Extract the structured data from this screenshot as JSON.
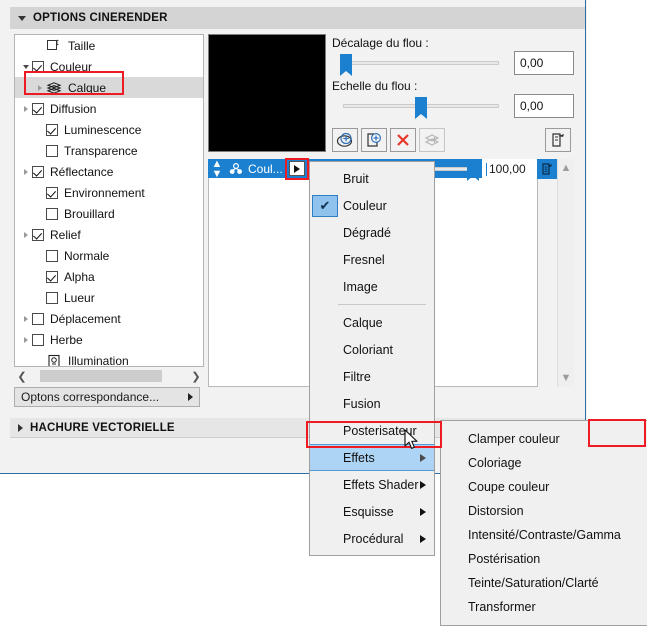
{
  "sections": {
    "cinerender": {
      "title": "OPTIONS CINERENDER",
      "expanded": true
    },
    "hachure": {
      "title": "HACHURE VECTORIELLE",
      "expanded": false
    }
  },
  "tree": {
    "items": [
      {
        "label": "Taille",
        "icon": "size-icon",
        "checkbox": "none",
        "arrow": "none",
        "depth": 1,
        "selected": false
      },
      {
        "label": "Couleur",
        "icon": "none",
        "checkbox": "checked",
        "arrow": "open",
        "depth": 0,
        "selected": false
      },
      {
        "label": "Calque",
        "icon": "layers-icon",
        "checkbox": "none",
        "arrow": "closed",
        "depth": 1,
        "selected": true
      },
      {
        "label": "Diffusion",
        "icon": "none",
        "checkbox": "checked",
        "arrow": "closed",
        "depth": 0,
        "selected": false
      },
      {
        "label": "Luminescence",
        "icon": "none",
        "checkbox": "checked",
        "arrow": "none",
        "depth": 1,
        "selected": false
      },
      {
        "label": "Transparence",
        "icon": "none",
        "checkbox": "unchecked",
        "arrow": "none",
        "depth": 1,
        "selected": false
      },
      {
        "label": "Réflectance",
        "icon": "none",
        "checkbox": "checked",
        "arrow": "closed",
        "depth": 0,
        "selected": false
      },
      {
        "label": "Environnement",
        "icon": "none",
        "checkbox": "checked",
        "arrow": "none",
        "depth": 1,
        "selected": false
      },
      {
        "label": "Brouillard",
        "icon": "none",
        "checkbox": "unchecked",
        "arrow": "none",
        "depth": 1,
        "selected": false
      },
      {
        "label": "Relief",
        "icon": "none",
        "checkbox": "checked",
        "arrow": "closed",
        "depth": 0,
        "selected": false
      },
      {
        "label": "Normale",
        "icon": "none",
        "checkbox": "unchecked",
        "arrow": "none",
        "depth": 1,
        "selected": false
      },
      {
        "label": "Alpha",
        "icon": "none",
        "checkbox": "checked",
        "arrow": "none",
        "depth": 1,
        "selected": false
      },
      {
        "label": "Lueur",
        "icon": "none",
        "checkbox": "unchecked",
        "arrow": "none",
        "depth": 1,
        "selected": false
      },
      {
        "label": "Déplacement",
        "icon": "none",
        "checkbox": "unchecked",
        "arrow": "closed",
        "depth": 0,
        "selected": false
      },
      {
        "label": "Herbe",
        "icon": "none",
        "checkbox": "unchecked",
        "arrow": "closed",
        "depth": 0,
        "selected": false
      },
      {
        "label": "Illumination",
        "icon": "illumination-icon",
        "checkbox": "none",
        "arrow": "none",
        "depth": 1,
        "selected": false
      }
    ]
  },
  "tree_footer": {
    "options_button": "Optons correspondance..."
  },
  "properties": {
    "blur_offset_label": "Décalage du flou :",
    "blur_offset_value": "0,00",
    "blur_scale_label": "Echelle du flou :",
    "blur_scale_value": "0,00"
  },
  "toolbar": {
    "buttons": [
      {
        "name": "add-shader-button",
        "icon": "sphere-plus-icon",
        "enabled": true
      },
      {
        "name": "add-image-button",
        "icon": "page-plus-icon",
        "enabled": true
      },
      {
        "name": "delete-button",
        "icon": "red-x-icon",
        "enabled": true
      },
      {
        "name": "duplicate-layer-button",
        "icon": "layers-arrow-icon",
        "enabled": false
      }
    ],
    "export_button": {
      "name": "export-icon",
      "icon": "page-arrow-icon"
    }
  },
  "layer_row": {
    "name": "Coul...",
    "icon": "shader-dots-icon",
    "popup_arrow": "play-arrow-icon",
    "opacity_value": "100,00",
    "opacity_slider_percent": 100
  },
  "menu": {
    "items": [
      {
        "label": "Bruit",
        "checked": false,
        "submenu": false,
        "highlight": false
      },
      {
        "label": "Couleur",
        "checked": true,
        "submenu": false,
        "highlight": false
      },
      {
        "label": "Dégradé",
        "checked": false,
        "submenu": false,
        "highlight": false
      },
      {
        "label": "Fresnel",
        "checked": false,
        "submenu": false,
        "highlight": false
      },
      {
        "label": "Image",
        "checked": false,
        "submenu": false,
        "highlight": false
      },
      {
        "separator": true
      },
      {
        "label": "Calque",
        "checked": false,
        "submenu": false,
        "highlight": false
      },
      {
        "label": "Coloriant",
        "checked": false,
        "submenu": false,
        "highlight": false
      },
      {
        "label": "Filtre",
        "checked": false,
        "submenu": false,
        "highlight": false
      },
      {
        "label": "Fusion",
        "checked": false,
        "submenu": false,
        "highlight": false
      },
      {
        "label": "Posterisateur",
        "checked": false,
        "submenu": false,
        "highlight": false
      },
      {
        "label": "Effets",
        "checked": false,
        "submenu": true,
        "highlight": true
      },
      {
        "label": "Effets Shader",
        "checked": false,
        "submenu": true,
        "highlight": false
      },
      {
        "label": "Esquisse",
        "checked": false,
        "submenu": true,
        "highlight": false
      },
      {
        "label": "Procédural",
        "checked": false,
        "submenu": true,
        "highlight": false
      }
    ]
  },
  "submenu": {
    "items": [
      {
        "label": "Clamper couleur"
      },
      {
        "label": "Coloriage"
      },
      {
        "label": "Coupe couleur"
      },
      {
        "label": "Distorsion"
      },
      {
        "label": "Intensité/Contraste/Gamma"
      },
      {
        "label": "Postérisation"
      },
      {
        "label": "Teinte/Saturation/Clarté"
      },
      {
        "label": "Transformer"
      }
    ]
  },
  "colors": {
    "accent": "#1b80d0",
    "highlight": "#aed4f5",
    "annotation": "#ee1b24",
    "panel_bg": "#f2f2f2",
    "header_bg": "#d4d4d4"
  }
}
